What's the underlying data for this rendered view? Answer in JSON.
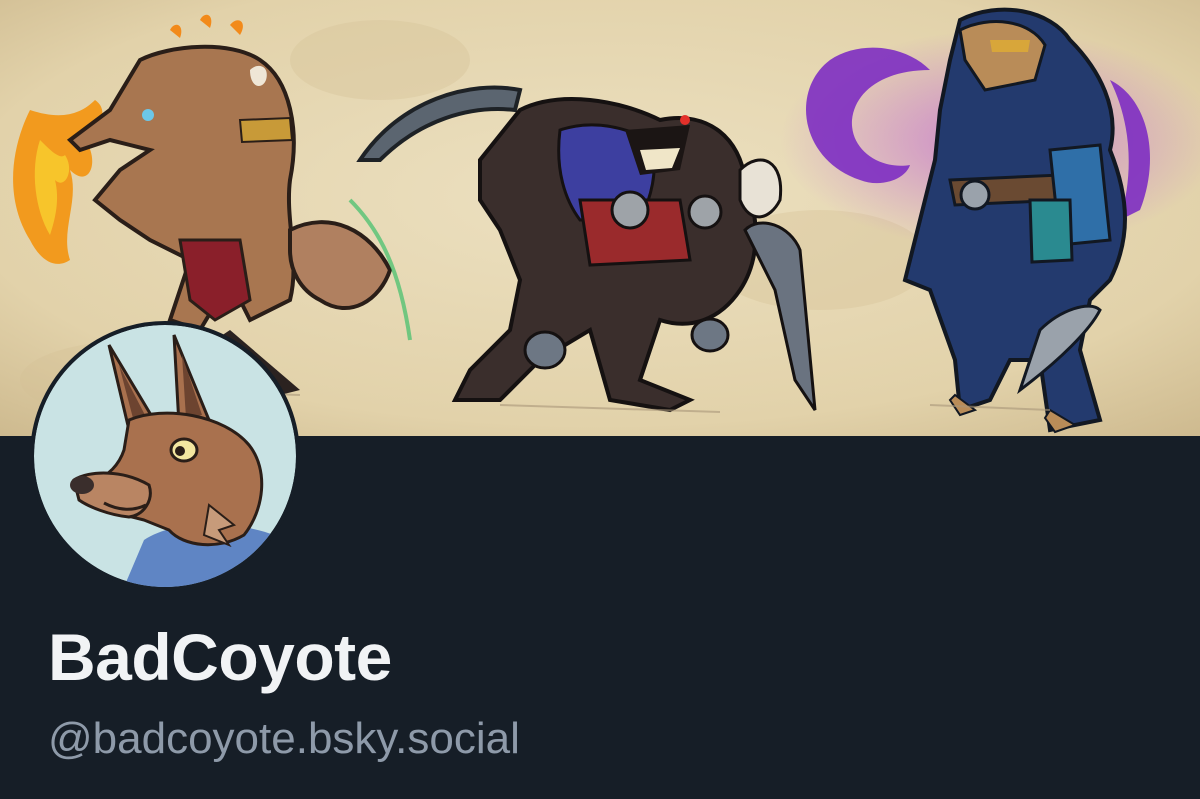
{
  "profile": {
    "display_name": "BadCoyote",
    "handle": "@badcoyote.bsky.social"
  },
  "colors": {
    "background": "#161e27",
    "display_name": "#f1f3f5",
    "handle": "#8e9aa9",
    "banner_parchment": "#e6d8b4"
  }
}
